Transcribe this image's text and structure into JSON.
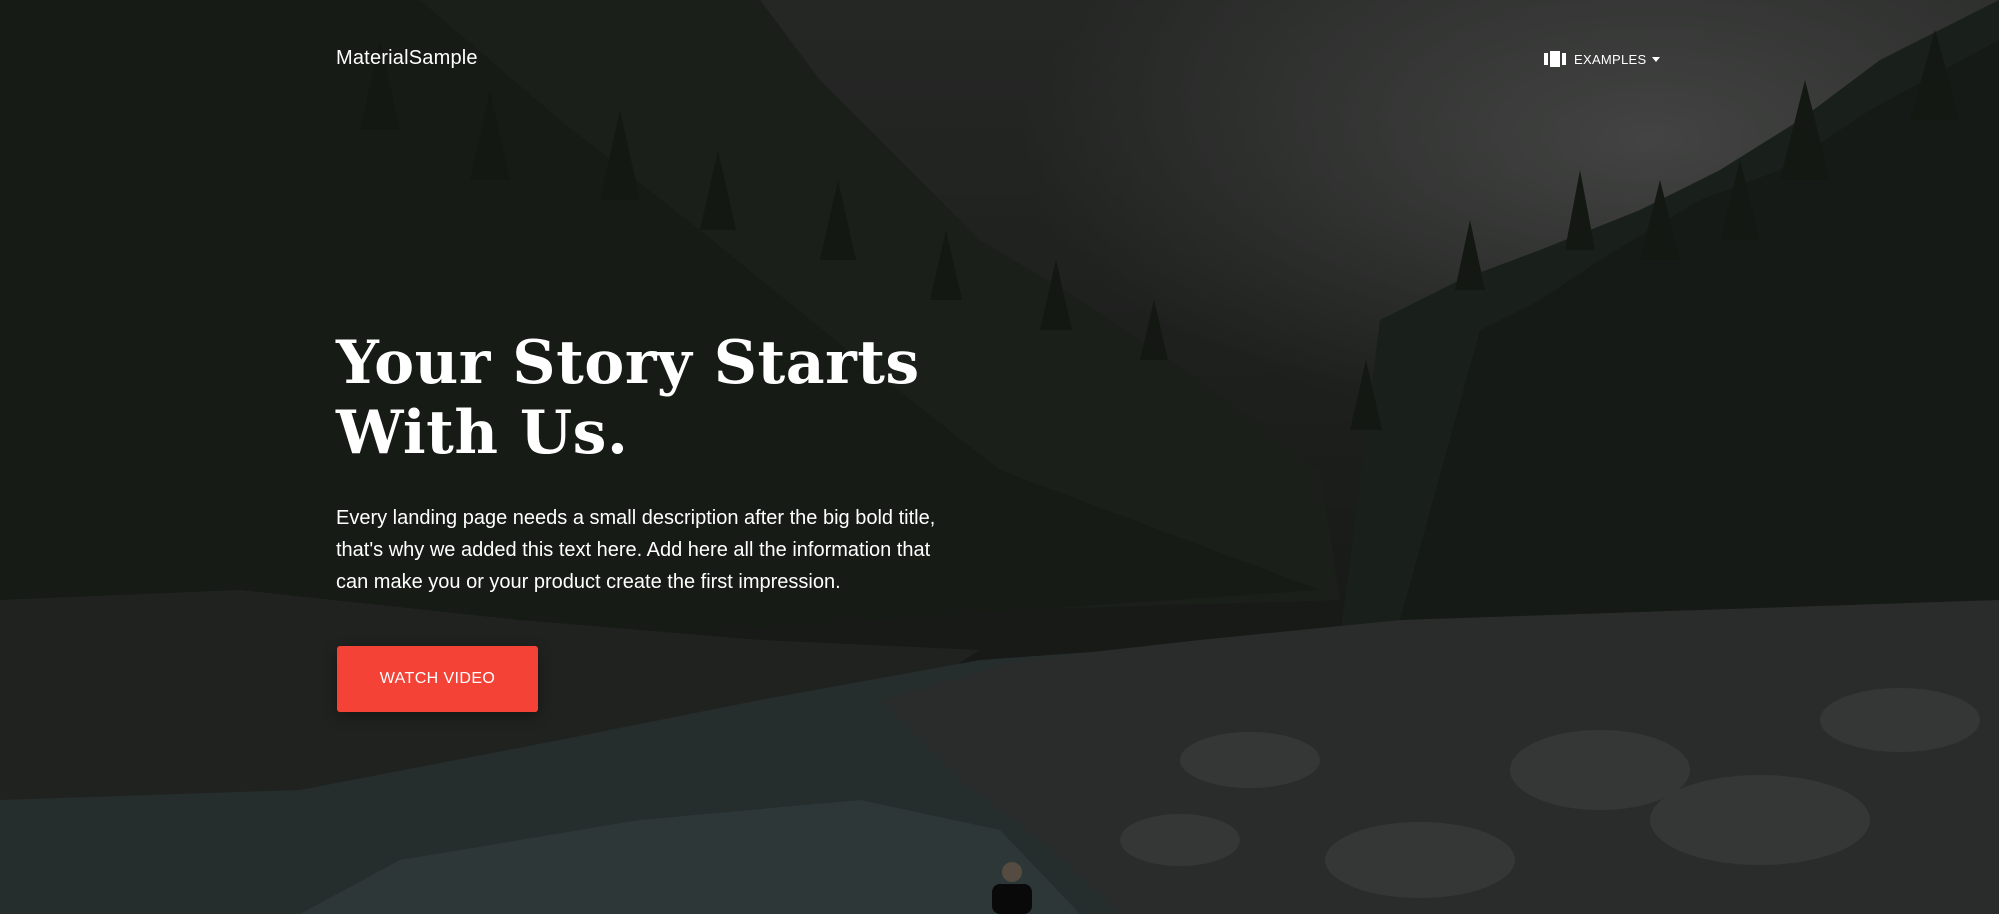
{
  "navbar": {
    "brand": "MaterialSample",
    "dropdown_label": "EXAMPLES",
    "dropdown_icon": "view-carousel-icon"
  },
  "hero": {
    "title_line1": "Your Story Starts",
    "title_line2": "With Us.",
    "description_line1": "Every landing page needs a small description after the big bold title,",
    "description_line2": "that's why we added this text here. Add here all the information that",
    "description_line3": "can make you or your product create the first impression.",
    "cta_label": "WATCH VIDEO",
    "background": "mountain-river-forest-photo"
  },
  "colors": {
    "accent": "#f44336",
    "text": "#ffffff"
  }
}
